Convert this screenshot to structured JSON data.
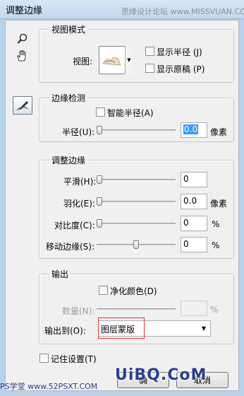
{
  "window": {
    "title": "调整边缘",
    "watermark_top": "思缘设计论坛 www.MISSVUAN.COM"
  },
  "tools": {
    "zoom_icon": "magnifier-icon",
    "hand_icon": "hand-icon",
    "refine_icon": "refine-radius-brush-icon"
  },
  "view_mode": {
    "legend": "视图模式",
    "view_label": "视图:",
    "show_radius_label": "显示半径 (J)",
    "show_original_label": "显示原稿 (P)",
    "show_radius_checked": false,
    "show_original_checked": false
  },
  "edge_detection": {
    "legend": "边缘检测",
    "smart_radius_label": "智能半径(A)",
    "smart_radius_checked": false,
    "radius_label": "半径(U):",
    "radius_value": "0.0",
    "radius_unit": "像素",
    "radius_slider": 0
  },
  "adjust_edge": {
    "legend": "调整边缘",
    "smooth_label": "平滑(H):",
    "smooth_value": "0",
    "smooth_slider": 0,
    "feather_label": "羽化(E):",
    "feather_value": "0.0",
    "feather_unit": "像素",
    "feather_slider": 0,
    "contrast_label": "对比度(C):",
    "contrast_value": "0",
    "contrast_unit": "%",
    "contrast_slider": 0,
    "shift_edge_label": "移动边缘(S):",
    "shift_edge_value": "0",
    "shift_edge_unit": "%",
    "shift_edge_slider": 0.5
  },
  "output": {
    "legend": "输出",
    "decontaminate_label": "净化颜色(D)",
    "decontaminate_checked": false,
    "amount_label": "数量(N):",
    "amount_value": "",
    "amount_unit": "%",
    "output_to_label": "输出到(O):",
    "output_to_value": "图层蒙版",
    "highlight_color": "#e23a2f"
  },
  "footer": {
    "remember_label": "记住设置(T)",
    "remember_checked": false,
    "ok_label": "确",
    "cancel_label": "取消"
  },
  "watermarks": {
    "left": "PS学堂 www.52PSXT.COM",
    "logo": "UiBQ.CoM"
  }
}
